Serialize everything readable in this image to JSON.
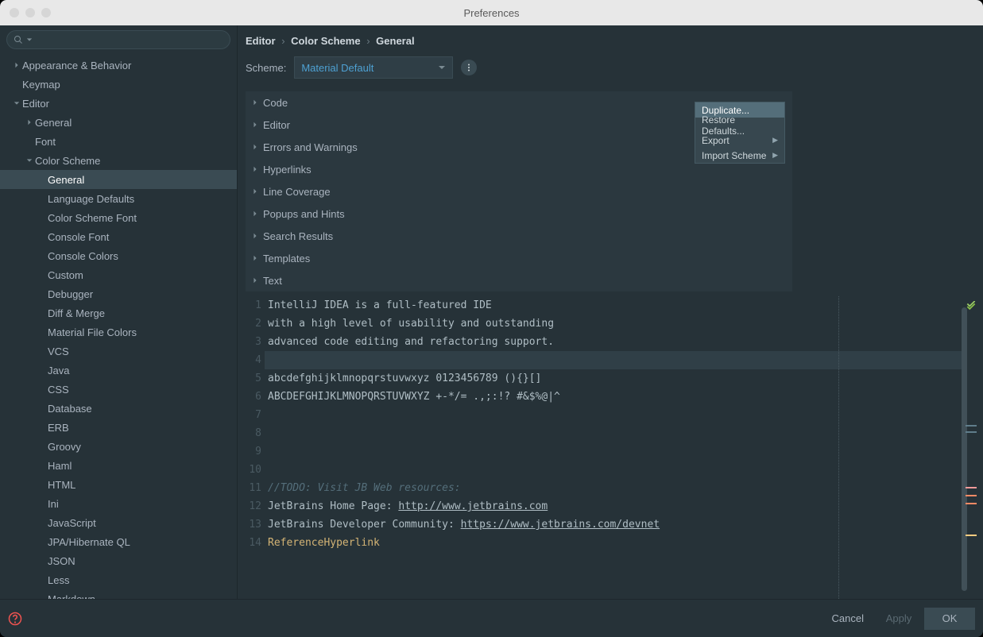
{
  "window": {
    "title": "Preferences"
  },
  "search": {
    "placeholder": ""
  },
  "sidebar": {
    "items": [
      {
        "label": "Appearance & Behavior",
        "indent": 0,
        "chevron": "right"
      },
      {
        "label": "Keymap",
        "indent": 0,
        "chevron": "none"
      },
      {
        "label": "Editor",
        "indent": 0,
        "chevron": "down"
      },
      {
        "label": "General",
        "indent": 1,
        "chevron": "right"
      },
      {
        "label": "Font",
        "indent": 1,
        "chevron": "none"
      },
      {
        "label": "Color Scheme",
        "indent": 1,
        "chevron": "down"
      },
      {
        "label": "General",
        "indent": 2,
        "chevron": "none",
        "selected": true
      },
      {
        "label": "Language Defaults",
        "indent": 2,
        "chevron": "none"
      },
      {
        "label": "Color Scheme Font",
        "indent": 2,
        "chevron": "none"
      },
      {
        "label": "Console Font",
        "indent": 2,
        "chevron": "none"
      },
      {
        "label": "Console Colors",
        "indent": 2,
        "chevron": "none"
      },
      {
        "label": "Custom",
        "indent": 2,
        "chevron": "none"
      },
      {
        "label": "Debugger",
        "indent": 2,
        "chevron": "none"
      },
      {
        "label": "Diff & Merge",
        "indent": 2,
        "chevron": "none"
      },
      {
        "label": "Material File Colors",
        "indent": 2,
        "chevron": "none"
      },
      {
        "label": "VCS",
        "indent": 2,
        "chevron": "none"
      },
      {
        "label": "Java",
        "indent": 2,
        "chevron": "none"
      },
      {
        "label": "CSS",
        "indent": 2,
        "chevron": "none"
      },
      {
        "label": "Database",
        "indent": 2,
        "chevron": "none"
      },
      {
        "label": "ERB",
        "indent": 2,
        "chevron": "none"
      },
      {
        "label": "Groovy",
        "indent": 2,
        "chevron": "none"
      },
      {
        "label": "Haml",
        "indent": 2,
        "chevron": "none"
      },
      {
        "label": "HTML",
        "indent": 2,
        "chevron": "none"
      },
      {
        "label": "Ini",
        "indent": 2,
        "chevron": "none"
      },
      {
        "label": "JavaScript",
        "indent": 2,
        "chevron": "none"
      },
      {
        "label": "JPA/Hibernate QL",
        "indent": 2,
        "chevron": "none"
      },
      {
        "label": "JSON",
        "indent": 2,
        "chevron": "none"
      },
      {
        "label": "Less",
        "indent": 2,
        "chevron": "none"
      },
      {
        "label": "Markdown",
        "indent": 2,
        "chevron": "none"
      }
    ]
  },
  "breadcrumb": {
    "a": "Editor",
    "b": "Color Scheme",
    "c": "General"
  },
  "scheme": {
    "label": "Scheme:",
    "value": "Material Default"
  },
  "popup": {
    "items": [
      {
        "label": "Duplicate...",
        "highlight": true,
        "submenu": false
      },
      {
        "label": "Restore Defaults...",
        "highlight": false,
        "submenu": false
      },
      {
        "label": "Export",
        "highlight": false,
        "submenu": true
      },
      {
        "label": "Import Scheme",
        "highlight": false,
        "submenu": true
      }
    ]
  },
  "categories": [
    "Code",
    "Editor",
    "Errors and Warnings",
    "Hyperlinks",
    "Line Coverage",
    "Popups and Hints",
    "Search Results",
    "Templates",
    "Text"
  ],
  "editor": {
    "lines": [
      {
        "n": "1",
        "segs": [
          {
            "t": "IntelliJ IDEA is a full-featured IDE",
            "cls": "token-grey"
          }
        ]
      },
      {
        "n": "2",
        "segs": [
          {
            "t": "with a high level of usability and outstanding",
            "cls": "token-grey"
          }
        ]
      },
      {
        "n": "3",
        "segs": [
          {
            "t": "advanced code editing and refactoring support.",
            "cls": "token-grey"
          }
        ]
      },
      {
        "n": "4",
        "segs": [],
        "current": true
      },
      {
        "n": "5",
        "segs": [
          {
            "t": "abcdefghijklmnopqrstuvwxyz 0123456789 (){}[]",
            "cls": "token-grey"
          }
        ]
      },
      {
        "n": "6",
        "segs": [
          {
            "t": "ABCDEFGHIJKLMNOPQRSTUVWXYZ +-*/= .,;:!? #&$%@|^",
            "cls": "token-grey"
          }
        ]
      },
      {
        "n": "7",
        "segs": []
      },
      {
        "n": "8",
        "segs": []
      },
      {
        "n": "9",
        "segs": []
      },
      {
        "n": "10",
        "segs": []
      },
      {
        "n": "11",
        "segs": [
          {
            "t": "//TODO: Visit JB Web resources:",
            "cls": "token-comment"
          }
        ]
      },
      {
        "n": "12",
        "segs": [
          {
            "t": "JetBrains Home Page: ",
            "cls": "token-grey"
          },
          {
            "t": "http://www.jetbrains.com",
            "cls": "token-link"
          }
        ]
      },
      {
        "n": "13",
        "segs": [
          {
            "t": "JetBrains Developer Community: ",
            "cls": "token-grey"
          },
          {
            "t": "https://www.jetbrains.com/devnet",
            "cls": "token-link"
          }
        ]
      },
      {
        "n": "14",
        "segs": [
          {
            "t": "ReferenceHyperlink",
            "cls": "token-ref"
          }
        ]
      }
    ]
  },
  "buttons": {
    "cancel": "Cancel",
    "apply": "Apply",
    "ok": "OK"
  }
}
